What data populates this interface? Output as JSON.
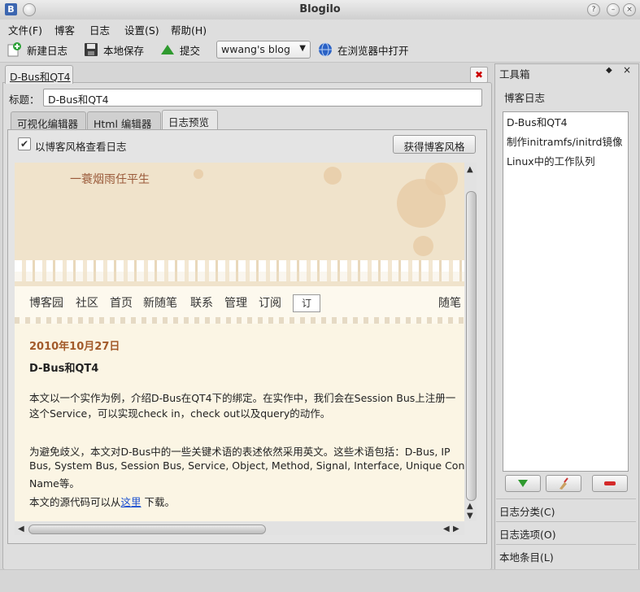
{
  "window": {
    "title": "Blogilo"
  },
  "menu": {
    "items": [
      "文件(F)",
      "博客",
      "日志",
      "设置(S)",
      "帮助(H)"
    ]
  },
  "toolbar": {
    "new_post": "新建日志",
    "save_local": "本地保存",
    "submit": "提交",
    "blog_selected": "wwang's blog",
    "open_browser": "在浏览器中打开"
  },
  "doc": {
    "tab_label": "D-Bus和QT4",
    "title_label": "标题：",
    "title_value": "D-Bus和QT4",
    "editor_tabs": [
      "可视化编辑器",
      "Html 编辑器",
      "日志预览"
    ],
    "preview_checkbox_label": "以博客风格查看日志",
    "fetch_style_button": "获得博客风格"
  },
  "webpage": {
    "site_name": "一蓑烟雨任平生",
    "nav": [
      "博客园",
      "社区",
      "首页",
      "新随笔",
      "联系",
      "管理",
      "订阅"
    ],
    "nav_box": "订",
    "nav_right": "随笔",
    "post_date": "2010年10月27日",
    "post_title": "D-Bus和QT4",
    "para1_line1": "本文以一个实作为例，介绍D-Bus在QT4下的绑定。在实作中，我们会在Session Bus上注册一",
    "para1_line2": "这个Service，可以实现check in，check out以及query的动作。",
    "para2_line1": "为避免歧义，本文对D-Bus中的一些关键术语的表述依然采用英文。这些术语包括：D-Bus, IP",
    "para2_line2": "Bus, System Bus, Session Bus, Service, Object, Method, Signal, Interface, Unique Connecti",
    "para2_line3": "Name等。",
    "para3_prefix": "本文的源代码可以从",
    "para3_link": "这里",
    "para3_suffix": " 下载。"
  },
  "toolbox": {
    "title": "工具箱",
    "posts_header": "博客日志",
    "posts": [
      "D-Bus和QT4",
      "制作initramfs/initrd镜像",
      "Linux中的工作队列"
    ],
    "sections": [
      "日志分类(C)",
      "日志选项(O)",
      "本地条目(L)"
    ]
  }
}
